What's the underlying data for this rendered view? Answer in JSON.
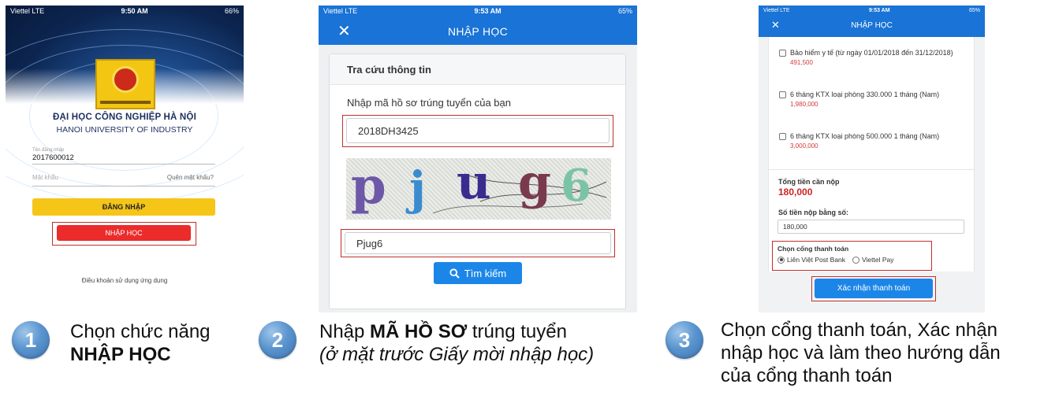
{
  "screen1": {
    "status": {
      "carrier": "Viettel  LTE",
      "time": "9:50 AM",
      "battery": "66%"
    },
    "university_vn": "ĐẠI HỌC CÔNG NGHIỆP HÀ NỘI",
    "university_en": "HANOI UNIVERSITY OF INDUSTRY",
    "username_label": "Tên đăng nhập",
    "username_value": "2017600012",
    "password_placeholder": "Mật khẩu",
    "forgot_password": "Quên mật khẩu?",
    "login_button": "ĐĂNG NHẬP",
    "enroll_button": "NHẬP HỌC",
    "terms": "Điều khoản sử dụng ứng dụng"
  },
  "screen2": {
    "status": {
      "carrier": "Viettel  LTE",
      "time": "9:53 AM",
      "battery": "65%"
    },
    "nav_title": "NHẬP HỌC",
    "card_title": "Tra cứu thông tin",
    "prompt": "Nhập mã hồ sơ trúng tuyển của bạn",
    "profile_code": "2018DH3425",
    "captcha_chars": [
      "p",
      "j",
      "u",
      "g",
      "6"
    ],
    "captcha_input": "Pjug6",
    "search_button": "Tìm kiếm"
  },
  "screen3": {
    "status": {
      "carrier": "Viettel  LTE",
      "time": "9:53 AM",
      "battery": "65%"
    },
    "nav_title": "NHẬP HỌC",
    "options": [
      {
        "label": "Bảo hiểm y tế (từ ngày 01/01/2018 đến 31/12/2018)",
        "price": "491,500"
      },
      {
        "label": "6 tháng KTX loại phòng 330.000 1 tháng (Nam)",
        "price": "1,980,000"
      },
      {
        "label": "6 tháng KTX loại phòng 500.000 1 tháng (Nam)",
        "price": "3,000,000"
      }
    ],
    "total_label": "Tổng tiền cần nộp",
    "total_value": "180,000",
    "amount_label": "Số tiền nộp bằng số:",
    "amount_value": "180,000",
    "gateway_title": "Chọn cổng thanh toán",
    "gateway_options": [
      "Liên Việt Post Bank",
      "Viettel Pay"
    ],
    "confirm_button": "Xác nhận thanh toán"
  },
  "steps": [
    {
      "number": "1",
      "line1": "Chọn chức năng",
      "line2_bold": "NHẬP HỌC"
    },
    {
      "number": "2",
      "line1_pre": "Nhập ",
      "line1_bold": "MÃ HỒ SƠ",
      "line1_post": " trúng tuyển",
      "line2_italic": "(ở mặt trước Giấy mời nhập học)"
    },
    {
      "number": "3",
      "line1": "Chọn cổng thanh toán, Xác nhận",
      "line2": "nhập học và làm theo hướng dẫn",
      "line3": "của cổng thanh toán"
    }
  ],
  "colors": {
    "brand_blue": "#1a73d6",
    "button_blue": "#1c86e8",
    "highlight_red": "#c0302c",
    "login_yellow": "#f5c518",
    "enroll_red": "#ec2b2b",
    "step_badge": "#5b95cf"
  }
}
